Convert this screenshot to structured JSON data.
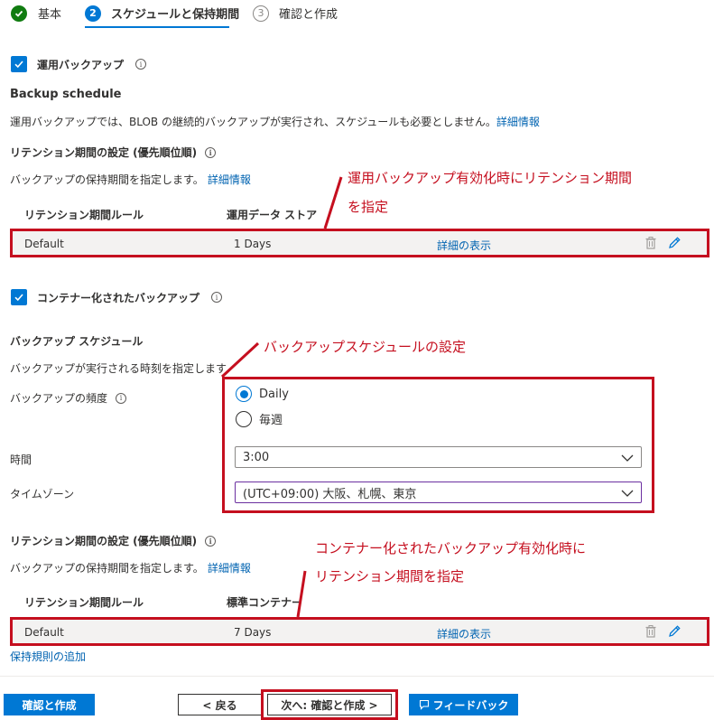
{
  "steps": [
    {
      "number": "",
      "label": "基本",
      "state": "done"
    },
    {
      "number": "2",
      "label": "スケジュールと保持期間",
      "state": "active"
    },
    {
      "number": "3",
      "label": "確認と作成",
      "state": "idle"
    }
  ],
  "operational": {
    "checkbox_label": "運用バックアップ",
    "schedule_title": "Backup schedule",
    "description": "運用バックアップでは、BLOB の継続的バックアップが実行され、スケジュールも必要としません。",
    "learn_more": "詳細情報",
    "retention_title": "リテンション期間の設定 (優先順位順)",
    "retention_desc": "バックアップの保持期間を指定します。",
    "retention_learn_more": "詳細情報",
    "table_headers": [
      "リテンション期間ルール",
      "運用データ ストア"
    ],
    "rows": [
      {
        "rule": "Default",
        "duration": "1 Days",
        "details": "詳細の表示"
      }
    ]
  },
  "container": {
    "checkbox_label": "コンテナー化されたバックアップ",
    "schedule_title": "バックアップ スケジュール",
    "schedule_desc": "バックアップが実行される時刻を指定します",
    "frequency_label": "バックアップの頻度",
    "frequency_options": [
      "Daily",
      "毎週"
    ],
    "frequency_selected": "Daily",
    "time_label": "時間",
    "time_value": "3:00",
    "timezone_label": "タイムゾーン",
    "timezone_value": "(UTC+09:00) 大阪、札幌、東京",
    "retention_title": "リテンション期間の設定 (優先順位順)",
    "retention_desc": "バックアップの保持期間を指定します。",
    "retention_learn_more": "詳細情報",
    "table_headers": [
      "リテンション期間ルール",
      "標準コンテナー"
    ],
    "rows": [
      {
        "rule": "Default",
        "duration": "7 Days",
        "details": "詳細の表示"
      }
    ],
    "add_rule": "保持規則の追加"
  },
  "annotations": {
    "a1_line1": "運用バックアップ有効化時にリテンション期間",
    "a1_line2": "を指定",
    "a2": "バックアップスケジュールの設定",
    "a3_line1": "コンテナー化されたバックアップ有効化時に",
    "a3_line2": "リテンション期間を指定"
  },
  "footer": {
    "review_create": "確認と作成",
    "back": "< 戻る",
    "next": "次へ: 確認と作成 >",
    "feedback": "フィードバック"
  },
  "colors": {
    "accent": "#0078d4",
    "annotation": "#c50f1f",
    "success": "#107c10"
  }
}
